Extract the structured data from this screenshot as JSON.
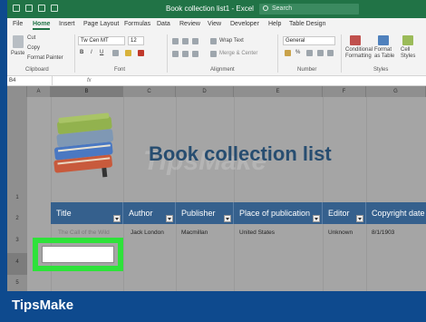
{
  "window": {
    "title": "Book collection list1 - Excel",
    "search_placeholder": "Search"
  },
  "tabs": [
    "File",
    "Home",
    "Insert",
    "Page Layout",
    "Formulas",
    "Data",
    "Review",
    "View",
    "Developer",
    "Help",
    "Table Design"
  ],
  "active_tab": "Home",
  "ribbon": {
    "clipboard": {
      "paste": "Paste",
      "cut": "Cut",
      "copy": "Copy",
      "format_painter": "Format Painter",
      "label": "Clipboard"
    },
    "font": {
      "name": "Tw Cen MT",
      "size": "12",
      "label": "Font"
    },
    "alignment": {
      "wrap_text": "Wrap Text",
      "merge": "Merge & Center",
      "label": "Alignment"
    },
    "number": {
      "format": "General",
      "percent": "%",
      "label": "Number"
    },
    "styles": {
      "conditional": "Conditional Formatting",
      "format_table": "Format as Table",
      "cell_styles": "Cell Styles",
      "label": "Styles"
    }
  },
  "formula_bar": {
    "name_box": "B4",
    "fx": "fx"
  },
  "columns": [
    "A",
    "B",
    "C",
    "D",
    "E",
    "F",
    "G"
  ],
  "rows": [
    "1",
    "2",
    "3",
    "4",
    "5"
  ],
  "sheet": {
    "title": "Book collection list",
    "headers": [
      "Title",
      "Author",
      "Publisher",
      "Place of publication",
      "Editor",
      "Copyright date"
    ],
    "row3": [
      "Jack London",
      "Macmillan",
      "United States",
      "Unknown",
      "8/1/1903"
    ],
    "row3_ghost": "The Call of the Wild"
  },
  "watermark": "TipsMake",
  "brand": "TipsMake",
  "colors": {
    "excel_green": "#217346",
    "header_blue": "#35608d",
    "highlight": "#2ee23a",
    "page_bg": "#0e4a8e"
  }
}
